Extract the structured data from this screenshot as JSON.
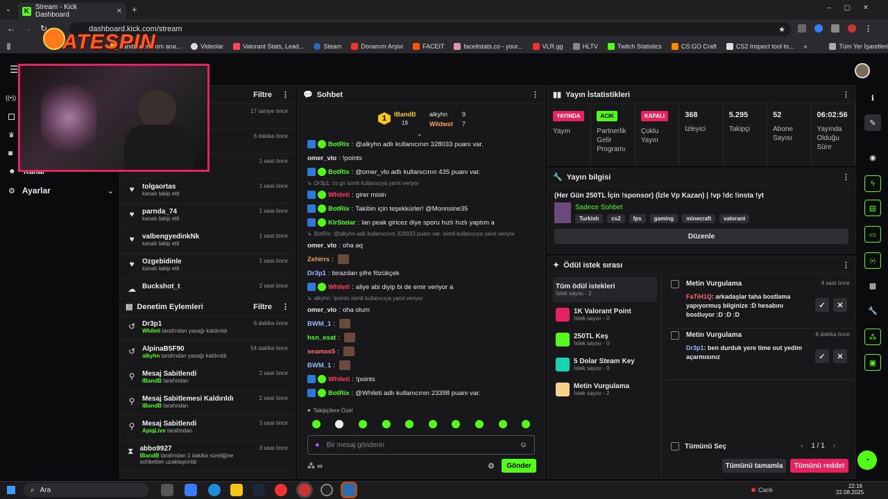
{
  "browser": {
    "tab_title": "Stream - Kick Dashboard",
    "url": "dashboard.kick.com/stream",
    "bookmarks": [
      "sahibinden.com ana...",
      "Videolar",
      "Valorant Stats, Lead...",
      "Steam",
      "Donanım Arşivi",
      "FACEIT",
      "faceitstats.co - your...",
      "VLR.gg",
      "HLTV",
      "Twitch Statistics",
      "CS:GO Craft",
      "CS2 Inspect tool to..."
    ],
    "all_bookmarks": "Tüm Yer İşaretleri",
    "overlay_logo": "ATESPIN"
  },
  "left": {
    "settings_label": "Ayarlar",
    "channel_label": "Kanal",
    "activity": {
      "filter": "Filtre",
      "items": [
        {
          "name": "",
          "sub": "",
          "time": "17 saniye önce"
        },
        {
          "name": "",
          "sub": "",
          "time": "6 dakika önce"
        },
        {
          "name": "",
          "sub": "kanalı takip etti",
          "time": "1 saat önce"
        },
        {
          "name": "tolgaortas",
          "sub": "kanalı takip etti",
          "time": "1 saat önce"
        },
        {
          "name": "parnda_74",
          "sub": "kanalı takip etti",
          "time": "1 saat önce"
        },
        {
          "name": "valbengyedinkNk",
          "sub": "kanalı takip etti",
          "time": "1 saat önce"
        },
        {
          "name": "Ozgebidinle",
          "sub": "kanalı takip etti",
          "time": "1 saat önce"
        },
        {
          "name": "Buckshot_t",
          "sub": "",
          "time": "2 saat önce"
        }
      ]
    },
    "moderation": {
      "title": "Denetim Eylemleri",
      "filter": "Filtre",
      "items": [
        {
          "name": "Dr3p1",
          "who": "Whileti",
          "rest": " tarafından yasağı kaldırıldı",
          "time": "6 dakika önce"
        },
        {
          "name": "AlpinaB5F90",
          "who": "alkyhn",
          "rest": " tarafından yasağı kaldırıldı",
          "time": "54 dakika önce"
        },
        {
          "name": "Mesaj Sabitlendi",
          "who": "IBandB",
          "rest": " tarafından",
          "time": "2 saat önce"
        },
        {
          "name": "Mesaj Sabitlemesi Kaldırıldı",
          "who": "IBandB",
          "rest": " tarafından",
          "time": "2 saat önce"
        },
        {
          "name": "Mesaj Sabitlendi",
          "who": "ApiqLive",
          "rest": " tarafından",
          "time": "3 saat önce"
        },
        {
          "name": "abbo9927",
          "who": "IBandB",
          "rest": " tarafından 1 dakika süreliğine sohbetten uzaklaştırıldı",
          "time": "3 saat önce"
        }
      ]
    }
  },
  "chat": {
    "title": "Sohbet",
    "top": [
      {
        "name": "IBandB",
        "count": "19",
        "rank": "1"
      },
      {
        "name": "alkyhn",
        "count": "9"
      },
      {
        "name": "Wildwst",
        "count": "7"
      }
    ],
    "lines": [
      {
        "user": "BotRix",
        "color": "#53fc18",
        "text": "@alkyhn adlı kullanıcının 328033 puanı var."
      },
      {
        "user": "omer_vlo",
        "color": "#e8e8e8",
        "text": "!points"
      },
      {
        "user": "BotRix",
        "color": "#53fc18",
        "text": "@omer_vlo adlı kullanıcının 435 puanı var."
      },
      {
        "sys": "Dr3p1: cs gir isimli kullanıcıya yanıt veriyor"
      },
      {
        "user": "Whileti",
        "color": "#ff3d5e",
        "text": "girer misin"
      },
      {
        "user": "BotRix",
        "color": "#53fc18",
        "text": "Takibin için teşekkürler! @Monnsine35"
      },
      {
        "user": "KlrStelar",
        "color": "#53fc18",
        "text": "lan peak giricez diye sporu hızlı hızlı yaptım a"
      },
      {
        "sys": "BotRix: @alkyhn adlı kullanıcının 328033 puanı var. isimli kullanıcıya yanıt veriyor"
      },
      {
        "user": "omer_vlo",
        "color": "#e8e8e8",
        "text": "oha aq"
      },
      {
        "user": "Zehirrs",
        "color": "#f5a25d",
        "text": ""
      },
      {
        "user": "Dr3p1",
        "color": "#9ab8ff",
        "text": "birazdan şifre fözükçek"
      },
      {
        "user": "Whileti",
        "color": "#ff3d5e",
        "text": "aliye abi diyip bi de emir veriyor a"
      },
      {
        "sys": "alkyhn: !points isimli kullanıcıya yanıt veriyor"
      },
      {
        "user": "omer_vlo",
        "color": "#e8e8e8",
        "text": "oha olum"
      },
      {
        "user": "BWM_1",
        "color": "#9ab8ff",
        "text": ""
      },
      {
        "user": "hsn_esat",
        "color": "#53fc18",
        "text": ""
      },
      {
        "user": "seamas5",
        "color": "#ff6b6b",
        "text": ""
      },
      {
        "user": "BWM_1",
        "color": "#9ab8ff",
        "text": ""
      },
      {
        "user": "Whileti",
        "color": "#ff3d5e",
        "text": "!points"
      },
      {
        "user": "BotRix",
        "color": "#53fc18",
        "text": "@Whileti adlı kullanıcının 23398 puanı var."
      }
    ],
    "follower_only": "Takipçilere Özel",
    "placeholder": "Bir mesaj gönderin",
    "send": "Gönder"
  },
  "stats": {
    "title": "Yayın İstatistikleri",
    "items": [
      {
        "badge": "YAYINDA",
        "badge_color": "#e6235f",
        "label": "Yayın"
      },
      {
        "badge": "ACIK",
        "badge_color": "#53fc18",
        "label": "Partnerlik Gelir Programı"
      },
      {
        "badge": "KAPALI",
        "badge_color": "#e6235f",
        "label": "Çoklu Yayın"
      },
      {
        "value": "368",
        "label": "İzleyici"
      },
      {
        "value": "5.295",
        "label": "Takipçi"
      },
      {
        "value": "52",
        "label": "Abone Sayısı"
      },
      {
        "value": "06:02:56",
        "label": "Yayında Olduğu Süre"
      }
    ]
  },
  "info": {
    "title": "Yayın bilgisi",
    "stream_title": "(Her Gün 250TL İçin !sponsor) (İzle Vp Kazan) | !vp !dc !insta !yt",
    "category": "Sadece Sohbet",
    "tags": [
      "Turkish",
      "cs2",
      "fps",
      "gaming",
      "minecraft",
      "valorant"
    ],
    "edit": "Düzenle"
  },
  "rewards": {
    "title": "Ödül istek sırası",
    "list": [
      {
        "name": "Tüm ödül istekleri",
        "sub": "İstek sayısı - 2"
      },
      {
        "name": "1K Valorant Point",
        "sub": "İstek sayısı - 0",
        "color": "#e6235f"
      },
      {
        "name": "250TL Keş",
        "sub": "İstek sayısı - 0",
        "color": "#53fc18"
      },
      {
        "name": "5 Dolar Steam Key",
        "sub": "İstek sayısı - 0",
        "color": "#18d2b4"
      },
      {
        "name": "Metin Vurgulama",
        "sub": "İstek sayısı - 2",
        "color": "#f5d28a"
      }
    ],
    "requests": [
      {
        "title": "Metin Vurgulama",
        "time": "4 saat önce",
        "user": "FaTiH1Q",
        "color": "#ff6b6b",
        "text": "arkadaşlar taha bostlama yapıyormuş bilginize :D hesabını bostluyor :D :D :D"
      },
      {
        "title": "Metin Vurgulama",
        "time": "6 dakika önce",
        "user": "Dr3p1",
        "color": "#9ab8ff",
        "text": "ben durduk yere time out yedim açarmısınız"
      }
    ],
    "select_all": "Tümünü Seç",
    "page": "1 / 1",
    "complete_all": "Tümünü tamamla",
    "reject_all": "Tümünü reddet"
  },
  "taskbar": {
    "search": "Ara",
    "live": "Canlı",
    "time": "22:16",
    "date": "22.08.2025"
  }
}
